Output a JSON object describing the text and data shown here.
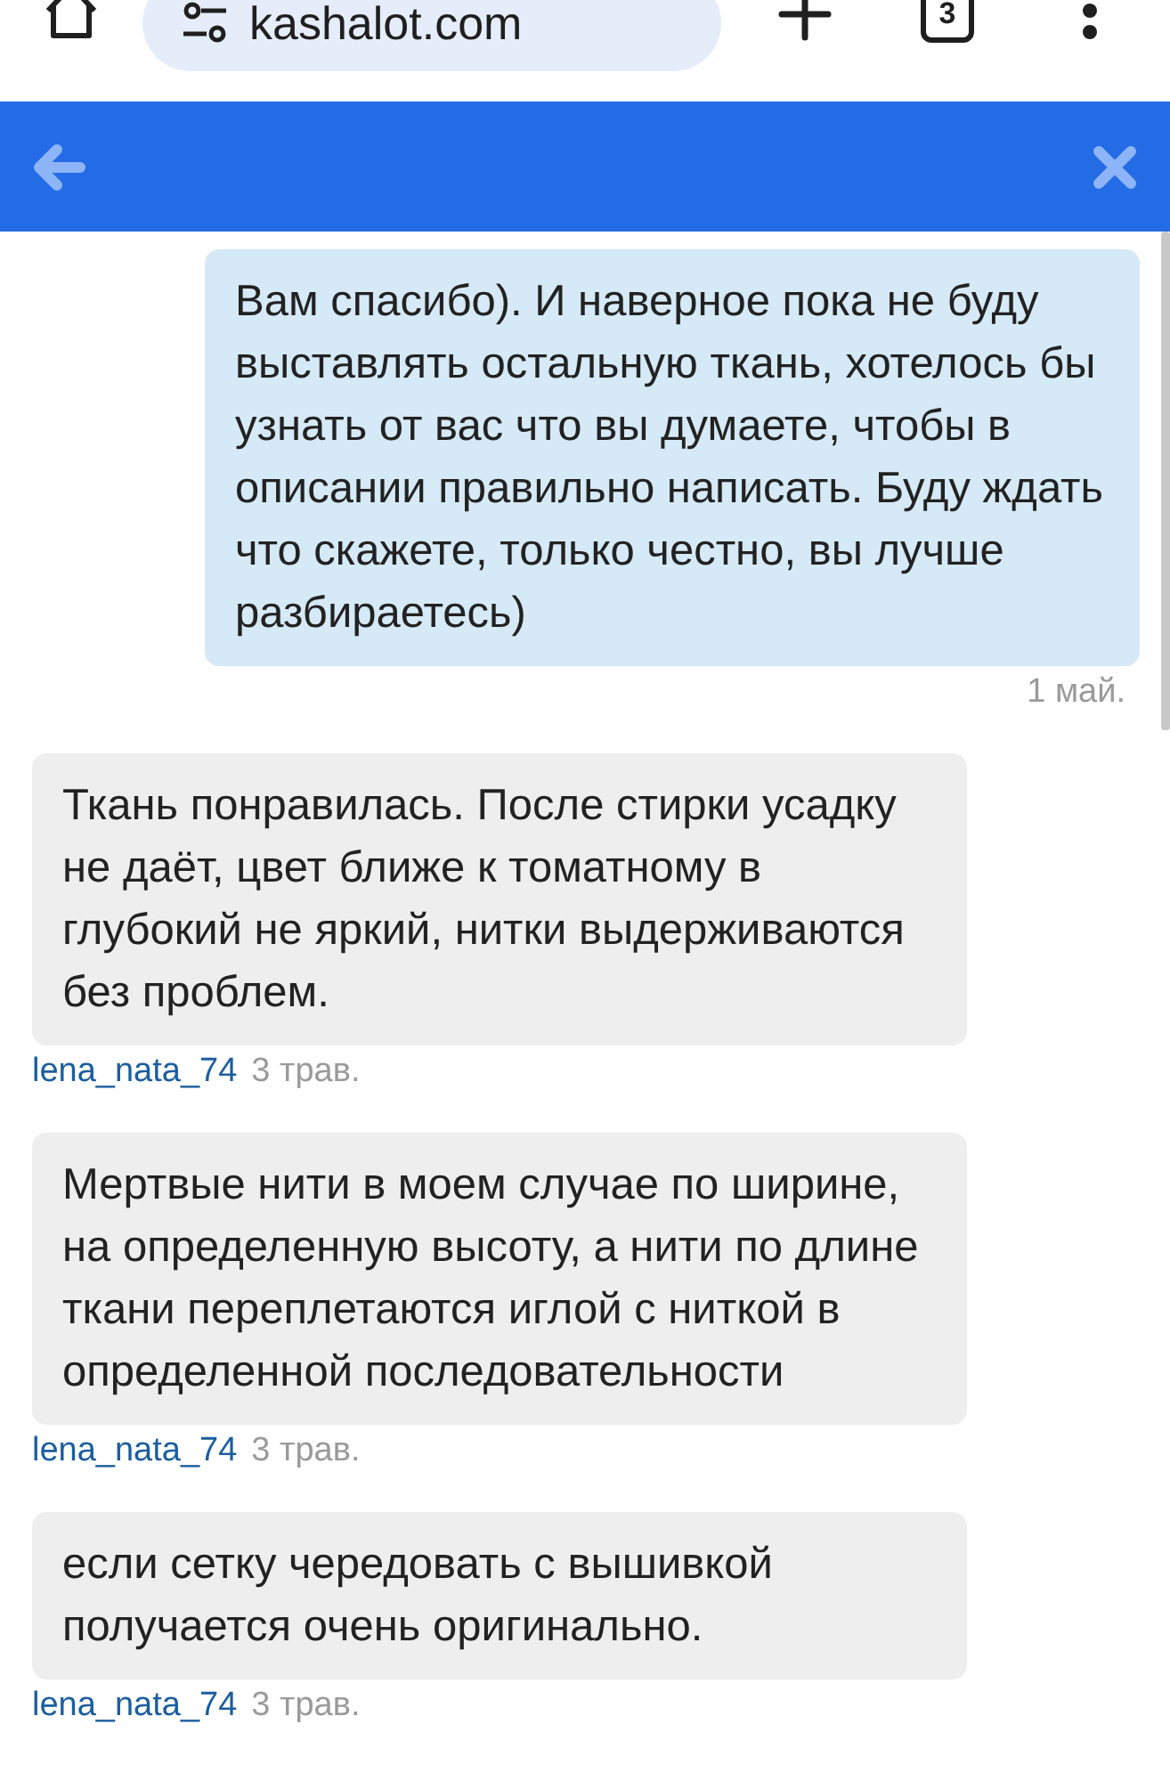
{
  "browser": {
    "url": "kashalot.com",
    "tab_count": "3"
  },
  "messages": [
    {
      "kind": "outgoing",
      "text": "Вам спасибо). И наверное пока не буду выставлять остальную ткань, хотелось бы узнать от вас что вы думаете, чтобы в описании правильно написать. Буду ждать что скажете, только честно, вы лучше разбираетесь)",
      "time": "1 май."
    },
    {
      "kind": "incoming",
      "text": "Ткань понравилась. После стирки усадку не даёт, цвет ближе к томатному в глубокий не яркий, нитки выдерживаются без проблем.",
      "author": "lena_nata_74",
      "time": "3 трав."
    },
    {
      "kind": "incoming",
      "text": "Мертвые нити в моем случае по ширине, на определенную высоту, а нити по длине ткани переплетаются иглой с ниткой в определенной последовательности",
      "author": "lena_nata_74",
      "time": "3 трав."
    },
    {
      "kind": "incoming",
      "text": "если сетку чередовать с вышивкой получается очень оригинально.",
      "author": "lena_nata_74",
      "time": "3 трав."
    }
  ]
}
